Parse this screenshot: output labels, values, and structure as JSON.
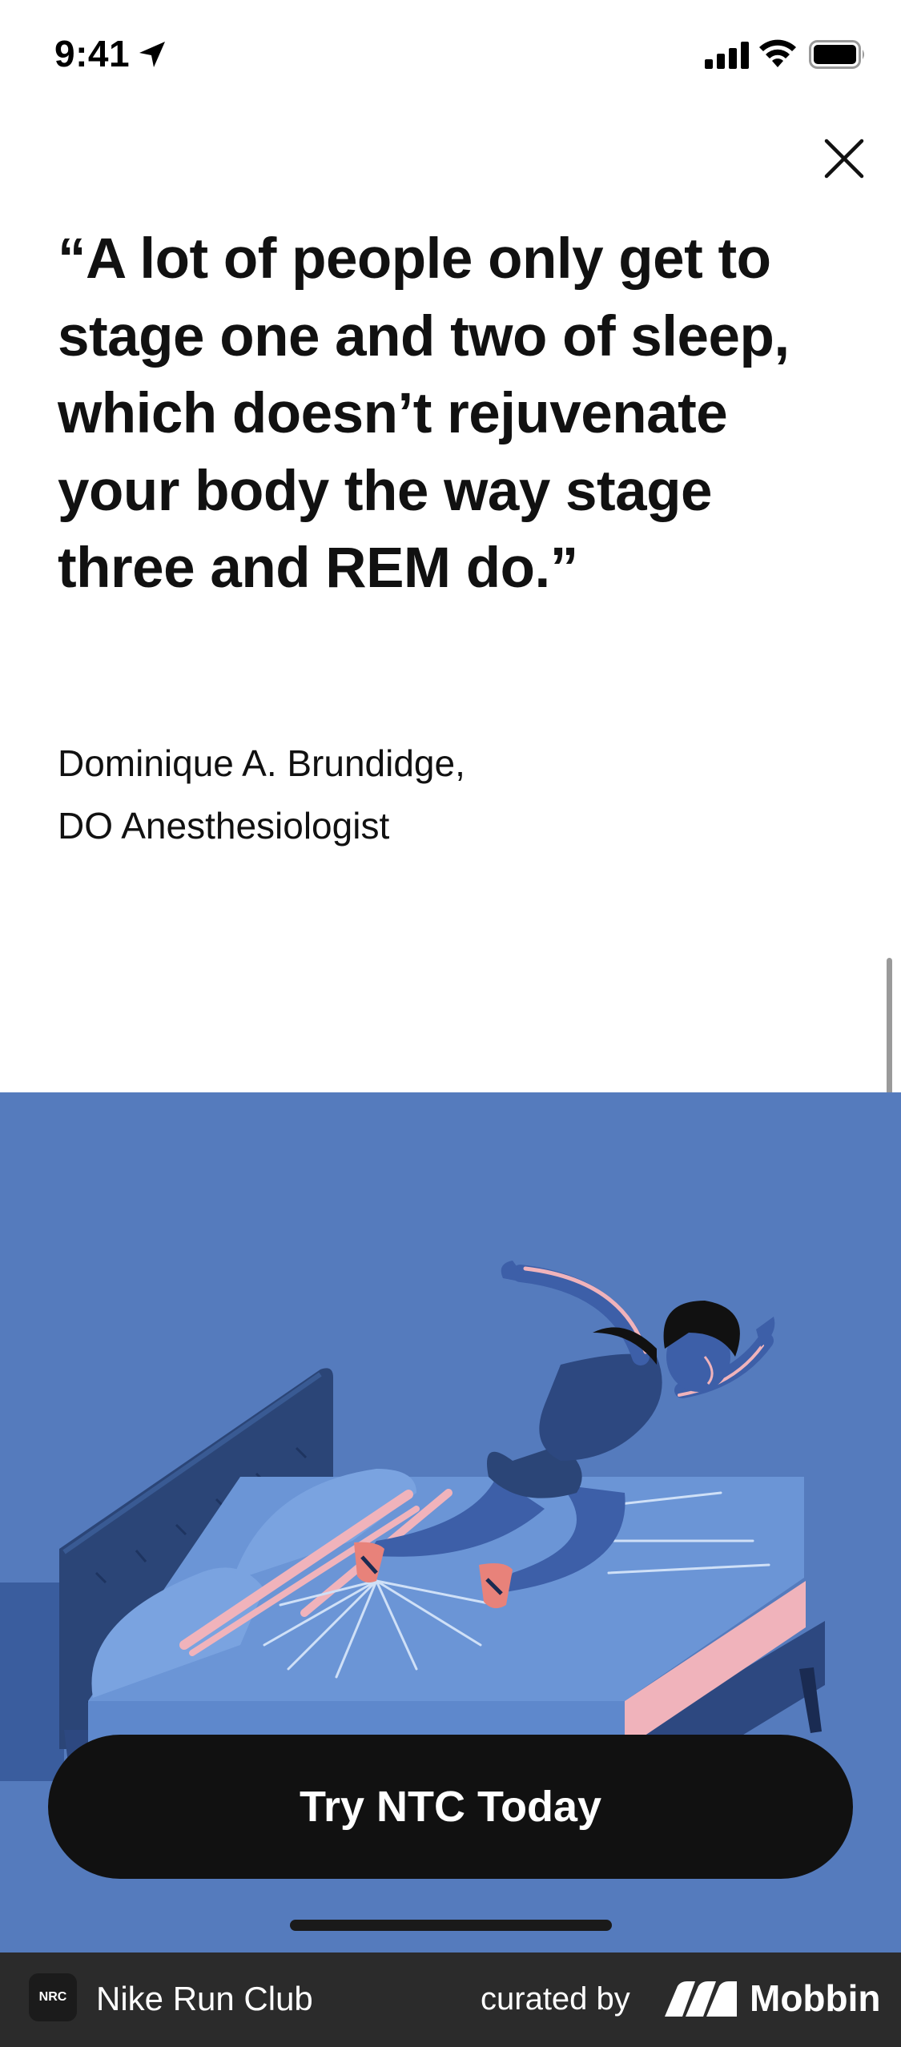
{
  "status_bar": {
    "time": "9:41",
    "icons": [
      "location-arrow-icon",
      "cellular-signal-icon",
      "wifi-icon",
      "battery-icon"
    ]
  },
  "close": {
    "icon": "close-icon"
  },
  "quote": {
    "text": "“A lot of people only get to stage one and two of sleep, which doesn’t rejuvenate your body the way stage three and REM do.”"
  },
  "author": {
    "name": "Dominique A. Brundidge,",
    "title": "DO Anesthesiologist"
  },
  "illustration": {
    "description_icon": "woman-jumping-off-bed-illustration",
    "background": "#557bbd"
  },
  "cta": {
    "label": "Try NTC Today"
  },
  "footer": {
    "app_icon_label": "NRC",
    "app_name": "Nike Run Club",
    "curated_by": "curated by",
    "brand": "Mobbin"
  },
  "colors": {
    "cta_background": "#111111",
    "footer_background": "#2b2b2b",
    "illustration_blue": "#557bbd"
  }
}
